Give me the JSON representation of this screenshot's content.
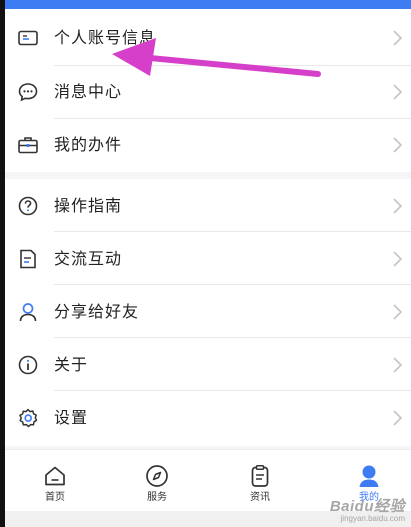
{
  "menu_group_1": [
    {
      "label": "个人账号信息",
      "icon": "id-card-icon"
    },
    {
      "label": "消息中心",
      "icon": "chat-bubble-icon"
    },
    {
      "label": "我的办件",
      "icon": "briefcase-icon"
    }
  ],
  "menu_group_2": [
    {
      "label": "操作指南",
      "icon": "help-circle-icon"
    },
    {
      "label": "交流互动",
      "icon": "document-icon"
    },
    {
      "label": "分享给好友",
      "icon": "person-icon"
    },
    {
      "label": "关于",
      "icon": "info-icon"
    },
    {
      "label": "设置",
      "icon": "gear-icon"
    }
  ],
  "tabbar": [
    {
      "label": "首页",
      "icon": "home-icon"
    },
    {
      "label": "服务",
      "icon": "compass-icon"
    },
    {
      "label": "资讯",
      "icon": "clipboard-icon"
    },
    {
      "label": "我的",
      "icon": "profile-icon",
      "active": true
    }
  ],
  "colors": {
    "accent": "#3d7cf3",
    "annotation_arrow": "#d63fc9"
  },
  "watermark": {
    "main": "Baidu经验",
    "sub": "jingyan.baidu.com"
  }
}
